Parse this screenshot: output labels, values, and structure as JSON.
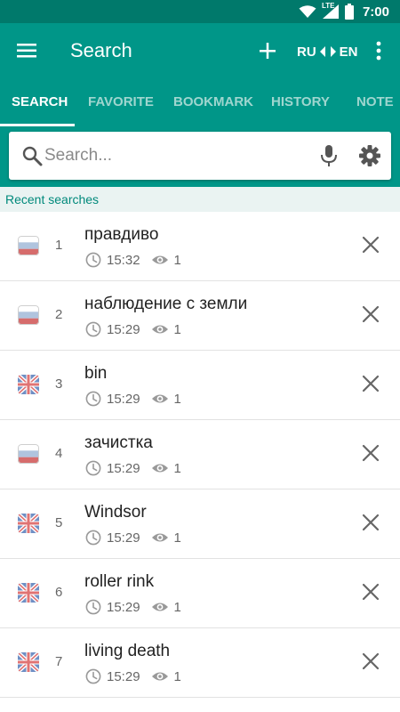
{
  "status_bar": {
    "network": "LTE",
    "time": "7:00"
  },
  "app_bar": {
    "title": "Search",
    "lang_from": "RU",
    "lang_to": "EN"
  },
  "tabs": [
    {
      "label": "SEARCH",
      "active": true
    },
    {
      "label": "FAVORITE",
      "active": false
    },
    {
      "label": "BOOKMARK",
      "active": false
    },
    {
      "label": "HISTORY",
      "active": false
    },
    {
      "label": "NOTE",
      "active": false
    }
  ],
  "search": {
    "placeholder": "Search...",
    "value": ""
  },
  "recent": {
    "label": "Recent searches",
    "items": [
      {
        "num": "1",
        "word": "правдиво",
        "time": "15:32",
        "views": "1",
        "lang": "ru"
      },
      {
        "num": "2",
        "word": "наблюдение с земли",
        "time": "15:29",
        "views": "1",
        "lang": "ru"
      },
      {
        "num": "3",
        "word": "bin",
        "time": "15:29",
        "views": "1",
        "lang": "en"
      },
      {
        "num": "4",
        "word": "зачистка",
        "time": "15:29",
        "views": "1",
        "lang": "ru"
      },
      {
        "num": "5",
        "word": "Windsor",
        "time": "15:29",
        "views": "1",
        "lang": "en"
      },
      {
        "num": "6",
        "word": "roller rink",
        "time": "15:29",
        "views": "1",
        "lang": "en"
      },
      {
        "num": "7",
        "word": "living death",
        "time": "15:29",
        "views": "1",
        "lang": "en"
      }
    ]
  },
  "colors": {
    "primary": "#009688",
    "primary_dark": "#00796b",
    "accent_text": "#00897b",
    "tab_inactive": "#9fd6cf"
  },
  "icons": {
    "menu": "hamburger-icon",
    "add": "plus-icon",
    "swap": "swap-arrows-icon",
    "more": "more-vert-icon",
    "search": "search-icon",
    "mic": "mic-icon",
    "settings": "gear-icon",
    "clock": "clock-icon",
    "views": "eye-icon",
    "remove": "close-icon",
    "flag_ru": "russia-flag-icon",
    "flag_en": "uk-flag-icon"
  }
}
